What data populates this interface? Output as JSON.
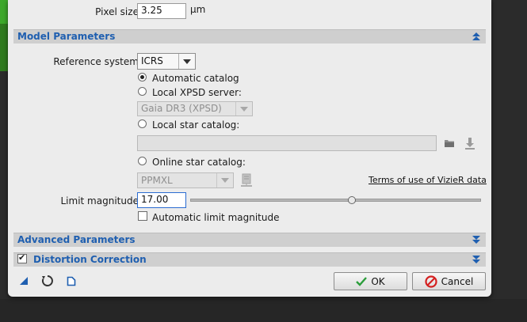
{
  "pixel_size": {
    "label": "Pixel size:",
    "value": "3.25",
    "unit": "µm"
  },
  "model_parameters": {
    "title": "Model Parameters",
    "reference_system_label": "Reference system:",
    "reference_system_value": "ICRS",
    "automatic_catalog_label": "Automatic catalog",
    "local_xpsd_label": "Local XPSD server:",
    "local_xpsd_value": "Gaia DR3 (XPSD)",
    "local_star_catalog_label": "Local star catalog:",
    "local_star_catalog_value": "",
    "online_star_catalog_label": "Online star catalog:",
    "online_star_catalog_value": "PPMXL",
    "terms_link": "Terms of use of VizieR data",
    "limit_magnitude_label": "Limit magnitude:",
    "limit_magnitude_value": "17.00",
    "limit_magnitude_slider_fraction": 0.56,
    "automatic_limit_magnitude_label": "Automatic limit magnitude",
    "selected_option": "Automatic catalog"
  },
  "advanced_parameters": {
    "title": "Advanced Parameters"
  },
  "distortion_correction": {
    "title": "Distortion Correction",
    "checked": true
  },
  "footer": {
    "ok_label": "OK",
    "cancel_label": "Cancel"
  },
  "colors": {
    "section_title": "#1f5fb0",
    "ok_icon": "#2a9d3a",
    "cancel_icon": "#d42020"
  },
  "icons": [
    "expand-up-icon",
    "expand-down-icon",
    "folder-icon",
    "download-icon",
    "server-icon",
    "new-instance-icon",
    "reset-icon",
    "document-icon",
    "check-icon",
    "cancel-icon"
  ]
}
